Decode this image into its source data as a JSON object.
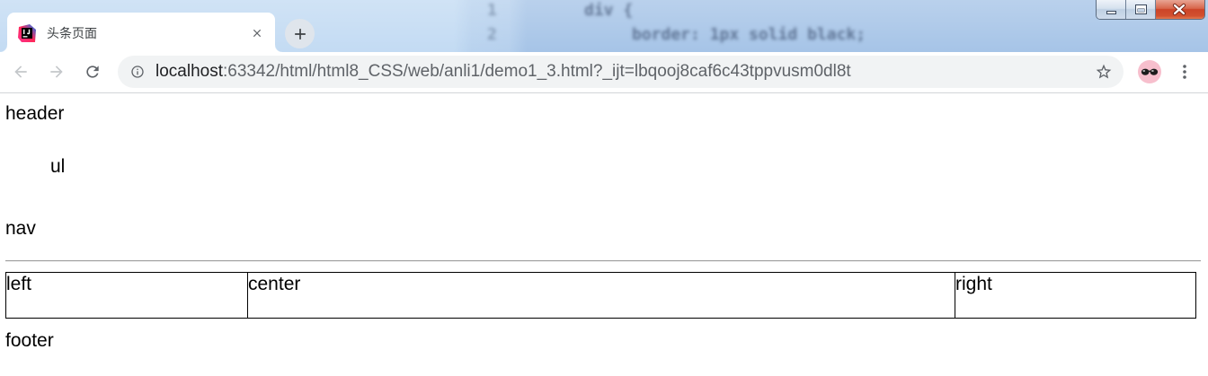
{
  "desktop_background": {
    "code_lines": [
      {
        "number": "1",
        "text": "div {"
      },
      {
        "number": "2",
        "text": "border: 1px solid black;"
      }
    ]
  },
  "window_controls": {
    "minimize_icon": "minimize-icon",
    "maximize_icon": "maximize-icon",
    "close_icon": "close-icon"
  },
  "tab": {
    "favicon": "intellij-idea-icon",
    "title": "头条页面",
    "close_icon": "close-icon"
  },
  "new_tab_button": {
    "icon": "plus-icon"
  },
  "toolbar": {
    "back_icon": "arrow-back-icon",
    "forward_icon": "arrow-forward-icon",
    "reload_icon": "reload-icon",
    "omnibox": {
      "site_info_icon": "info-icon",
      "url_host": "localhost",
      "url_rest": ":63342/html/html8_CSS/web/anli1/demo1_3.html?_ijt=lbqooj8caf6c43tppvusm0dl8t",
      "bookmark_icon": "star-outline-icon"
    },
    "profile_icon": "avatar-sunglasses-icon",
    "menu_icon": "more-vertical-icon"
  },
  "page": {
    "header": "header",
    "ul": "ul",
    "nav": "nav",
    "columns": [
      {
        "label": "left"
      },
      {
        "label": "center"
      },
      {
        "label": "right"
      }
    ],
    "footer": "footer"
  },
  "colors": {
    "tabstrip": "#c3dbf3",
    "tabstrip_dark": "#a6c4e7",
    "window_close": "#cc4428",
    "omnibox_bg": "#f1f3f4",
    "url_host": "#202124",
    "url_rest": "#5f6368",
    "column_border": "#000000",
    "page_text": "#000000"
  }
}
